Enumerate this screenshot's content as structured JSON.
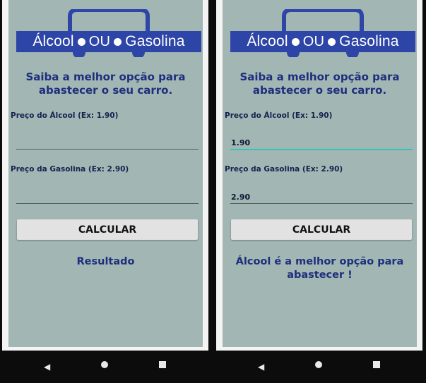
{
  "logo": {
    "left_word": "Álcool",
    "middle_word": "OU",
    "right_word": "Gasolina",
    "brand_color": "#2e45a8"
  },
  "headline": "Saiba a melhor opção para abastecer o seu carro.",
  "form": {
    "alcohol_label": "Preço do Álcool (Ex: 1.90)",
    "gasoline_label": "Preço da Gasolina (Ex: 2.90)",
    "calculate_label": "CALCULAR"
  },
  "screens": [
    {
      "alcohol_value": "",
      "gasoline_value": "",
      "result": "Resultado"
    },
    {
      "alcohol_value": "1.90",
      "gasoline_value": "2.90",
      "result": "Álcool é a melhor opção para abastecer !"
    }
  ],
  "nav": {
    "back_icon": "◀"
  }
}
